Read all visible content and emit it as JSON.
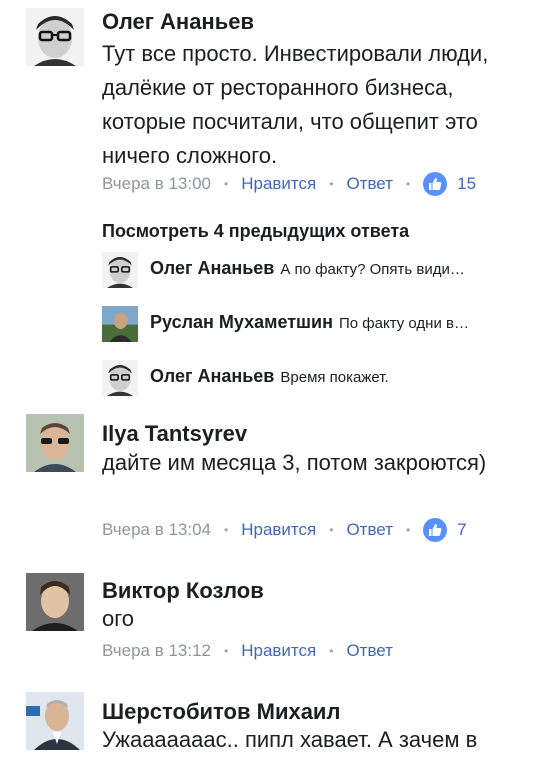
{
  "colors": {
    "link": "#4267b2",
    "meta": "#90949c",
    "like_badge": "#5890ff"
  },
  "comments": [
    {
      "author": "Олег Ананьев",
      "text": "Тут все просто. Инвестировали люди, далёкие от ресторанного бизнеса, которые посчитали, что общепит это ничего сложного.",
      "time": "Вчера в 13:00",
      "like_label": "Нравится",
      "reply_label": "Ответ",
      "likes": "15",
      "avatar_icon": "man-glasses-bw-avatar"
    },
    {
      "author": "Ilya Tantsyrev",
      "text": "дайте им месяца 3, потом закроются)",
      "time": "Вчера в 13:04",
      "like_label": "Нравится",
      "reply_label": "Ответ",
      "likes": "7",
      "avatar_icon": "man-sunglasses-avatar"
    },
    {
      "author": "Виктор Козлов",
      "text": "ого",
      "time": "Вчера в 13:12",
      "like_label": "Нравится",
      "reply_label": "Ответ",
      "avatar_icon": "young-man-avatar"
    },
    {
      "author": "Шерстобитов Михаил",
      "text": "Ужааааааас.. пипл хавает. А зачем в",
      "avatar_icon": "man-suit-avatar"
    }
  ],
  "replies_thread": {
    "view_previous": "Посмотреть 4 предыдущих ответа",
    "replies": [
      {
        "author": "Олег Ананьев",
        "text": "А по факту? Опять види…"
      },
      {
        "author": "Руслан Мухаметшин",
        "text": "По факту одни в…"
      },
      {
        "author": "Олег Ананьев",
        "text": "Время покажет."
      }
    ]
  }
}
